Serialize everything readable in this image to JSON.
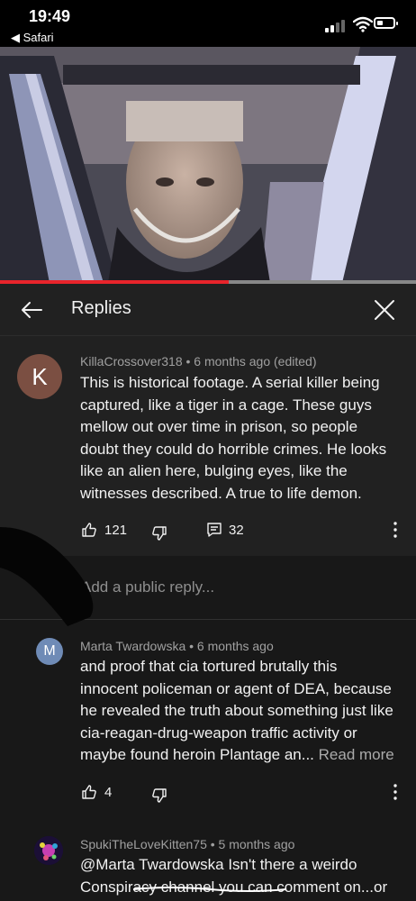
{
  "status_bar": {
    "time": "19:49",
    "back_app": "◀ Safari"
  },
  "video": {
    "progress_fraction": 0.55
  },
  "header": {
    "title": "Replies"
  },
  "parent_comment": {
    "avatar_letter": "K",
    "avatar_color": "#7b4f42",
    "author": "KillaCrossover318",
    "time": "• 6 months ago (edited)",
    "lines": [
      "This is historical footage. A serial killer being",
      "captured, like a tiger in a cage. These guys",
      "mellow out over time in prison, so people",
      "doubt they could do horrible crimes. He looks",
      "like an alien here, bulging eyes, like the",
      "witnesses described. A true to life demon."
    ],
    "likes": "121",
    "replies": "32"
  },
  "reply_input": {
    "placeholder": "Add a public reply..."
  },
  "replies": [
    {
      "avatar_letter": "M",
      "avatar_color": "#6f8bb6",
      "author": "Marta Twardowska",
      "time": "• 6 months ago",
      "lines": [
        "and proof that cia tortured brutally this",
        "innocent policeman or agent of DEA, because",
        "he revealed the truth about something just like",
        "cia-reagan-drug-weapon traffic activity or",
        "maybe found heroin Plantage an..."
      ],
      "read_more": "Read more",
      "likes": "4"
    },
    {
      "author": "SpukiTheLoveKitten75",
      "time": "• 5 months ago",
      "lines": [
        "@Marta Twardowska Isn't there a weirdo",
        "Conspiracy channel you can comment on...or"
      ]
    }
  ],
  "colors": {
    "accent_red": "#e8242b",
    "panel": "#212121",
    "background": "#181818"
  }
}
